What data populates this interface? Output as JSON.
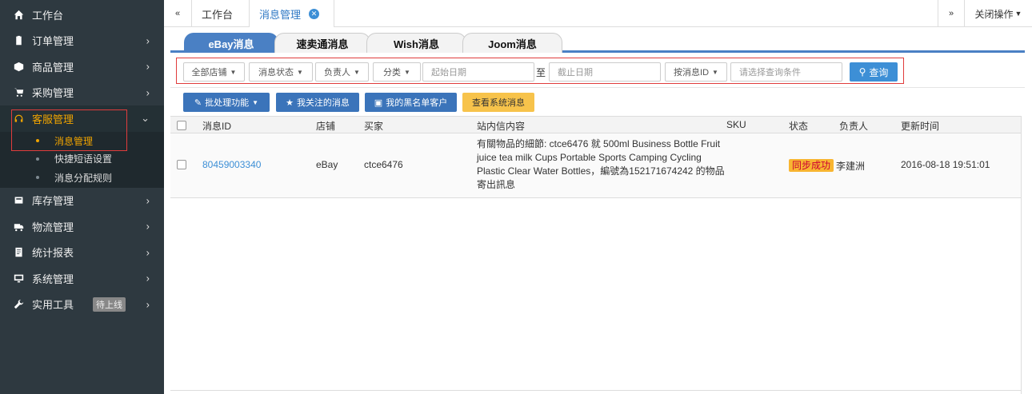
{
  "sidebar": {
    "items": [
      {
        "label": "工作台",
        "icon": "home-icon"
      },
      {
        "label": "订单管理",
        "icon": "clipboard-icon"
      },
      {
        "label": "商品管理",
        "icon": "cube-icon"
      },
      {
        "label": "采购管理",
        "icon": "cart-icon"
      },
      {
        "label": "客服管理",
        "icon": "headset-icon"
      },
      {
        "label": "库存管理",
        "icon": "database-icon"
      },
      {
        "label": "物流管理",
        "icon": "truck-icon"
      },
      {
        "label": "统计报表",
        "icon": "report-icon"
      },
      {
        "label": "系统管理",
        "icon": "monitor-icon"
      },
      {
        "label": "实用工具",
        "icon": "wrench-icon",
        "badge": "待上线"
      }
    ],
    "sub_items": [
      {
        "label": "消息管理"
      },
      {
        "label": "快捷短语设置"
      },
      {
        "label": "消息分配规则"
      }
    ],
    "arrow_right": "›",
    "arrow_down": "⌄"
  },
  "topbar": {
    "prev_icon": "«",
    "next_icon": "»",
    "tabs": [
      {
        "label": "工作台"
      },
      {
        "label": "消息管理"
      }
    ],
    "close_icon": "✕",
    "close_ops": "关闭操作"
  },
  "channel_tabs": [
    "eBay消息",
    "速卖通消息",
    "Wish消息",
    "Joom消息"
  ],
  "filters": {
    "store": "全部店铺",
    "msg_status": "消息状态",
    "owner": "负责人",
    "category": "分类",
    "start_date_placeholder": "起始日期",
    "to": "至",
    "end_date_placeholder": "截止日期",
    "by_id": "按消息ID",
    "condition_placeholder": "请选择查询条件",
    "search": "查询"
  },
  "actions": {
    "batch": "批处理功能",
    "followed": "我关注的消息",
    "blacklist": "我的黑名单客户",
    "system": "查看系统消息"
  },
  "table": {
    "headers": [
      "消息ID",
      "店铺",
      "买家",
      "站内信内容",
      "SKU",
      "状态",
      "负责人",
      "更新时间"
    ],
    "rows": [
      {
        "id": "80459003340",
        "store": "eBay",
        "buyer": "ctce6476",
        "content": "有關物品的細節: ctce6476 就 500ml Business Bottle Fruit juice tea milk Cups Portable Sports Camping Cycling Plastic Clear Water Bottles，編號為152171674242 的物品寄出訊息",
        "sku": "",
        "status": "同步成功",
        "owner": "李建洲",
        "updated": "2016-08-18 19:51:01"
      }
    ]
  },
  "colors": {
    "sidebar_bg": "#2e3940",
    "accent": "#f0a400",
    "primary": "#3d8fd6",
    "tab_blue": "#4a80c4"
  }
}
